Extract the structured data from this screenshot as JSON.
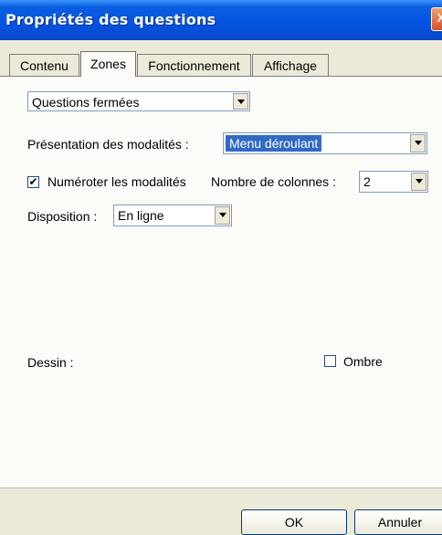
{
  "window": {
    "title": "Propriétés des questions",
    "close_glyph": "X"
  },
  "tabs": [
    {
      "label": "Contenu",
      "active": false
    },
    {
      "label": "Zones",
      "active": true
    },
    {
      "label": "Fonctionnement",
      "active": false
    },
    {
      "label": "Affichage",
      "active": false
    }
  ],
  "zones": {
    "question_type": {
      "value": "Questions fermées"
    },
    "presentation": {
      "label": "Présentation des modalités :",
      "value": "Menu déroulant"
    },
    "numbering": {
      "label": "Numéroter les modalités",
      "checked": true
    },
    "columns": {
      "label": "Nombre de colonnes :",
      "value": "2"
    },
    "layout": {
      "label": "Disposition :",
      "value": "En ligne"
    },
    "drawing": {
      "label": "Dessin :"
    },
    "shadow": {
      "label": "Ombre",
      "checked": false
    }
  },
  "buttons": {
    "ok": "OK",
    "cancel": "Annuler"
  },
  "colors": {
    "titlebar": "#0554e3",
    "selection": "#316ac5",
    "face": "#ece9d8"
  }
}
